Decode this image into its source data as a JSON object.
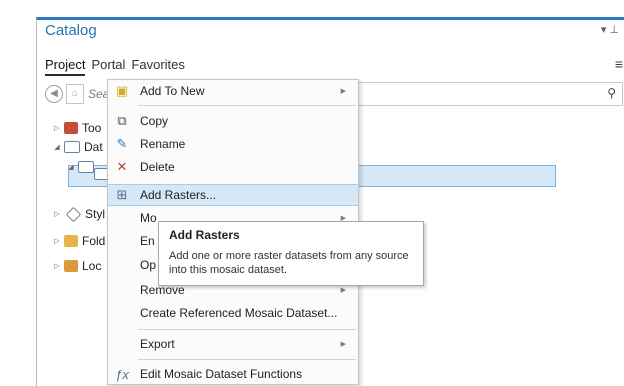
{
  "pane": {
    "title": "Catalog",
    "controls": "▾ ⊥",
    "tabs": [
      "Project",
      "Portal",
      "Favorites"
    ],
    "overflow_icon": "≡",
    "search_placeholder": "Sea",
    "search_icon": "search-icon"
  },
  "tree": {
    "items": [
      {
        "label": "Too",
        "icon": "toolbox-icon"
      },
      {
        "label": "Dat",
        "icon": "database-icon"
      },
      {
        "label": "",
        "icon": "geodatabase-icon"
      },
      {
        "label": "",
        "icon": "mosaic-dataset-icon"
      },
      {
        "label": "Styl",
        "icon": "styles-icon"
      },
      {
        "label": "Fold",
        "icon": "folder-icon"
      },
      {
        "label": "Loc",
        "icon": "locator-icon"
      }
    ]
  },
  "context_menu": {
    "items": [
      {
        "label": "Add To New",
        "has_submenu": true,
        "icon": "add-to-new-icon"
      },
      {
        "label": "Copy",
        "has_submenu": false,
        "icon": "copy-icon"
      },
      {
        "label": "Rename",
        "has_submenu": false,
        "icon": "rename-icon"
      },
      {
        "label": "Delete",
        "has_submenu": false,
        "icon": "delete-icon"
      },
      {
        "label": "Add Rasters...",
        "has_submenu": false,
        "icon": "add-rasters-icon",
        "highlighted": true
      },
      {
        "label": "Mo",
        "has_submenu": true,
        "icon": ""
      },
      {
        "label": "En",
        "has_submenu": false,
        "icon": ""
      },
      {
        "label": "Op",
        "has_submenu": false,
        "icon": ""
      },
      {
        "label": "Remove",
        "has_submenu": true,
        "icon": ""
      },
      {
        "label": "Create Referenced Mosaic Dataset...",
        "has_submenu": false,
        "icon": ""
      },
      {
        "label": "Export",
        "has_submenu": true,
        "icon": ""
      },
      {
        "label": "Edit Mosaic Dataset Functions",
        "has_submenu": false,
        "icon": "edit-functions-icon"
      }
    ]
  },
  "tooltip": {
    "title": "Add Rasters",
    "body": "Add one or more raster datasets from any source into this mosaic dataset."
  },
  "colors": {
    "accent": "#2b79c2",
    "selection": "#d5e8f7"
  }
}
